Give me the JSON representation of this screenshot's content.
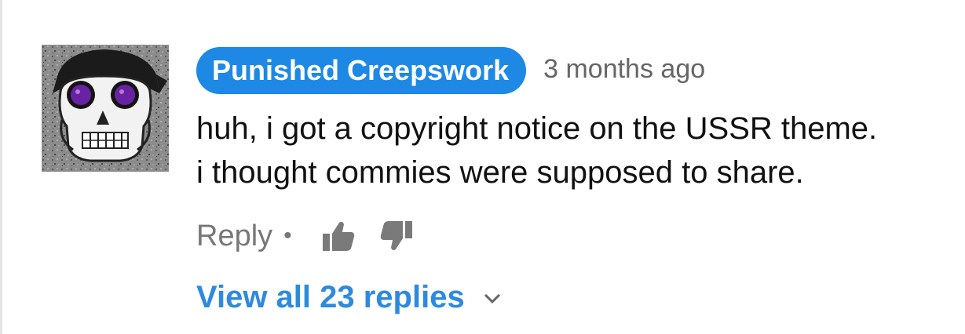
{
  "comment": {
    "author": "Punished Creepswork",
    "timestamp": "3 months ago",
    "text_lines": [
      "huh, i got a copyright notice on the USSR theme.",
      "i thought commies were supposed to share."
    ],
    "reply_label": "Reply",
    "separator": "•",
    "view_replies_label": "View all 23 replies",
    "icons": {
      "like": "thumbs-up-icon",
      "dislike": "thumbs-down-icon",
      "expand": "chevron-down-icon",
      "avatar": "skull-avatar"
    },
    "colors": {
      "author_chip_bg": "#1e88e5",
      "link_blue": "#2e8adf",
      "muted_gray": "#777777"
    }
  }
}
